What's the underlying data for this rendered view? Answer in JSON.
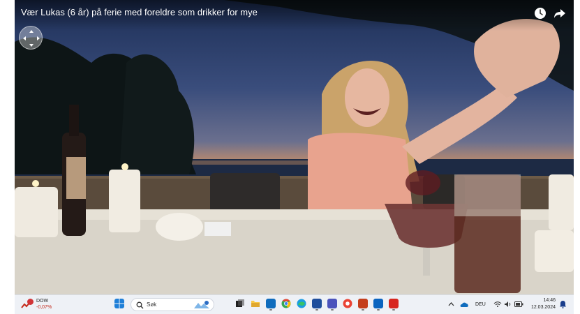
{
  "player": {
    "title": "Vær Lukas (6 år) på ferie med foreldre som drikker for mye",
    "icons": [
      "clock-icon",
      "share-icon",
      "vr-navigation-icon"
    ]
  },
  "taskbar": {
    "widget": {
      "label": "DOW",
      "value": "-0,07%",
      "badge_color": "#d13438"
    },
    "search": {
      "placeholder": "Søk"
    },
    "apps": [
      "windows-start-icon",
      "task-view-icon",
      "file-explorer-icon",
      "outlook-icon",
      "chrome-icon",
      "edge-icon",
      "microsoft-store-icon",
      "teams-icon",
      "chrome-profile-icon",
      "powerpoint-icon",
      "outlook-mail-icon",
      "acrobat-icon"
    ],
    "tray": {
      "language": "DEU",
      "time": "14:46",
      "date": "12.03.2024"
    }
  }
}
